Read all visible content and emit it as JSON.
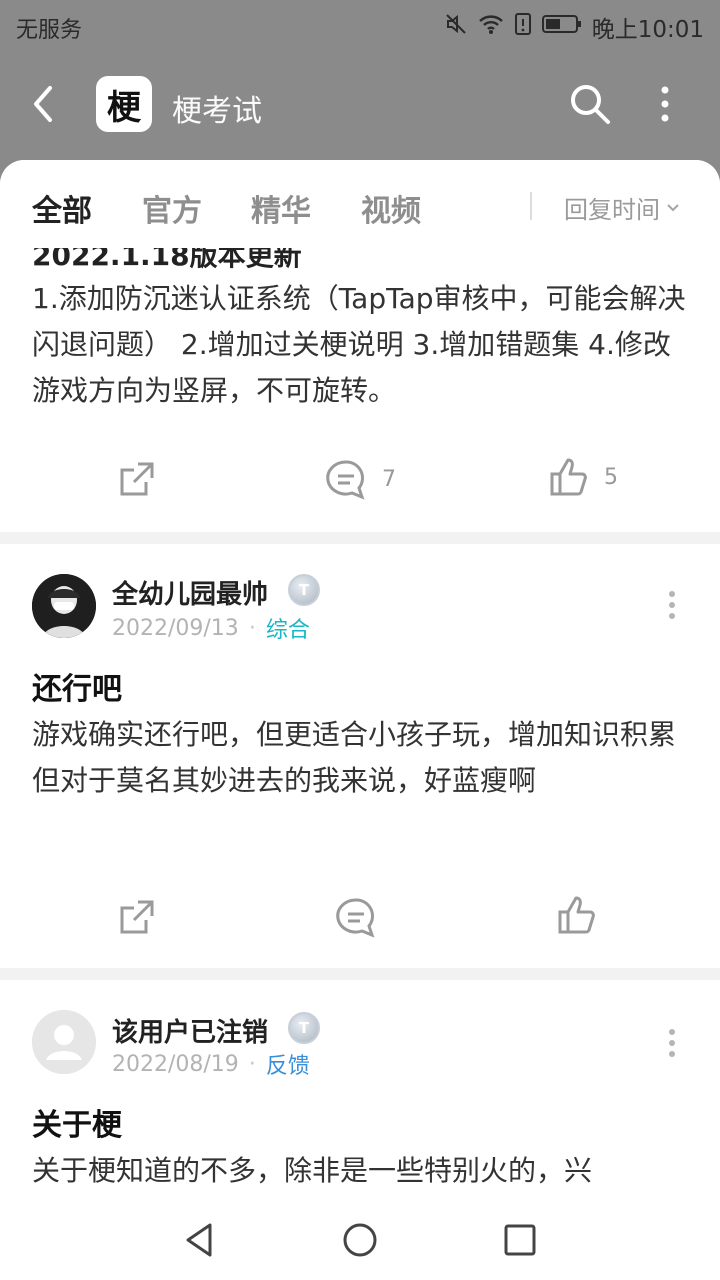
{
  "status_bar": {
    "carrier": "无服务",
    "time": "晚上10:01",
    "icons": [
      "mute-icon",
      "wifi-icon",
      "sim-alert-icon",
      "battery-icon"
    ]
  },
  "app_bar": {
    "logo_text": "梗",
    "title": "梗考试",
    "icons": [
      "back-icon",
      "search-icon",
      "more-vertical-icon"
    ]
  },
  "tabs": {
    "items": [
      {
        "label": "全部",
        "active": true
      },
      {
        "label": "官方",
        "active": false
      },
      {
        "label": "精华",
        "active": false
      },
      {
        "label": "视频",
        "active": false
      }
    ],
    "sort_label": "回复时间"
  },
  "posts": [
    {
      "partial_title": "2022.1.18版本更新",
      "body": "1.添加防沉迷认证系统（TapTap审核中，可能会解决闪退问题） 2.增加过关梗说明 3.增加错题集 4.修改游戏方向为竖屏，不可旋转。",
      "comments": "7",
      "likes": "5"
    },
    {
      "username": "全幼儿园最帅",
      "badge": "T",
      "date": "2022/09/13",
      "category": "综合",
      "title": "还行吧",
      "body": "游戏确实还行吧，但更适合小孩子玩，增加知识积累 但对于莫名其妙进去的我来说，好蓝瘦啊",
      "comments": "",
      "likes": ""
    },
    {
      "username": "该用户已注销",
      "badge": "T",
      "date": "2022/08/19",
      "category": "反馈",
      "title": "关于梗",
      "body": "关于梗知道的不多，除非是一些特别火的，兴"
    }
  ],
  "colors": {
    "accent": "#1bb6c6",
    "header_bg": "#8a8a8a"
  }
}
